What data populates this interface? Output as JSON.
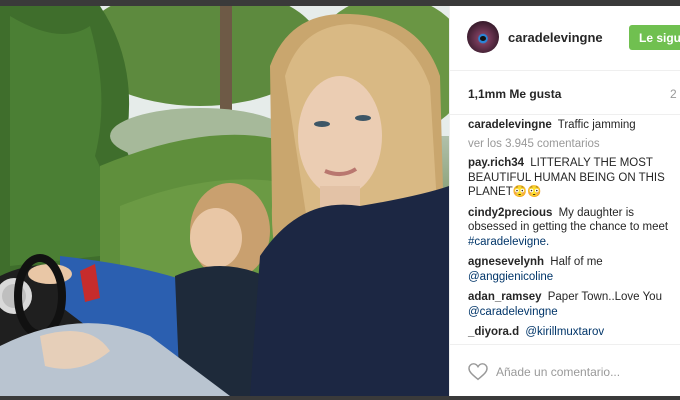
{
  "post": {
    "username": "caradelevingne",
    "follow_label": "Le sigue",
    "likes": "1,1mm Me gusta",
    "time_ago": "2",
    "caption": {
      "user": "caradelevingne",
      "text": "Traffic jamming"
    },
    "view_all_comments": "ver los 3.945 comentarios",
    "comments": [
      {
        "user": "pay.rich34",
        "text": "LITTERALY THE MOST BEAUTIFUL HUMAN BEING ON THIS PLANET😳😳",
        "tag": ""
      },
      {
        "user": "cindy2precious",
        "text": "My daughter is obsessed in getting the chance to meet",
        "tag": "#caradelevigne."
      },
      {
        "user": "agnesevelynh",
        "text": "Half of me",
        "tag": "@anggienicoline"
      },
      {
        "user": "adan_ramsey",
        "text": "Paper Town..Love You",
        "tag": "@caradelevingne"
      },
      {
        "user": "_diyora.d",
        "text": "",
        "tag": "@kirillmuxtarov"
      }
    ],
    "add_comment_placeholder": "Añade un comentario..."
  },
  "icons": {
    "avatar": "profile-avatar",
    "like": "heart-icon"
  },
  "colors": {
    "follow_button": "#70c050",
    "link": "#003569",
    "muted": "#999999"
  }
}
